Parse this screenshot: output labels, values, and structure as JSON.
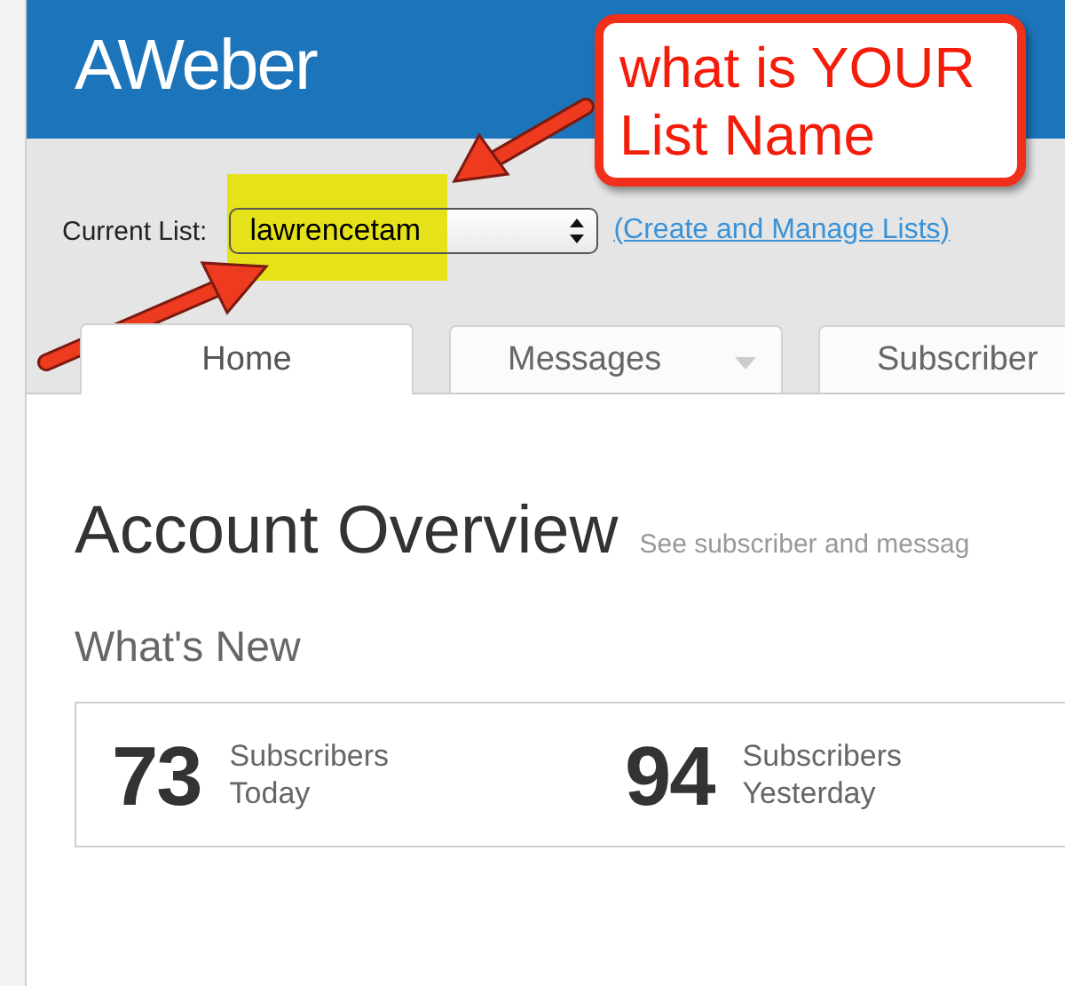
{
  "header": {
    "logo": "AWeber"
  },
  "list_selector": {
    "label": "Current List:",
    "value": "lawrencetam",
    "highlighted": true,
    "link": "(Create and Manage Lists)"
  },
  "tabs": [
    {
      "label": "Home",
      "selected": true,
      "has_menu": false
    },
    {
      "label": "Messages",
      "selected": false,
      "has_menu": true
    },
    {
      "label": "Subscriber",
      "selected": false
    }
  ],
  "page": {
    "title": "Account Overview",
    "subtitle": "See subscriber and messag",
    "section": "What's New"
  },
  "stats": [
    {
      "value": "73",
      "label_1": "Subscribers",
      "label_2": "Today"
    },
    {
      "value": "94",
      "label_1": "Subscribers",
      "label_2": "Yesterday"
    }
  ],
  "annotation": {
    "text": "what is YOUR\nList Name"
  }
}
